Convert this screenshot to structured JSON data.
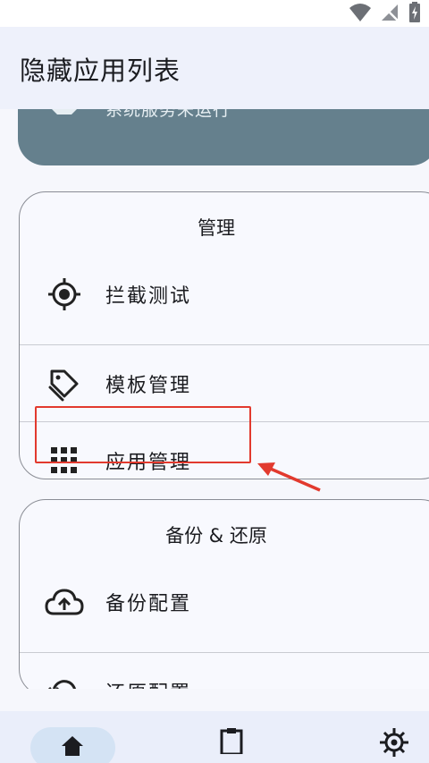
{
  "status_bar": {
    "icons": [
      "wifi-icon",
      "no-signal-icon",
      "battery-charging-icon"
    ]
  },
  "app_bar": {
    "title": "隐藏应用列表"
  },
  "status_card": {
    "text": "系统服务未运行",
    "icon": "service-icon",
    "color": "#65808d"
  },
  "manage_group": {
    "title": "管理",
    "items": [
      {
        "label": "拦截测试",
        "icon": "target-icon"
      },
      {
        "label": "模板管理",
        "icon": "tag-icon"
      },
      {
        "label": "应用管理",
        "icon": "grid-icon"
      }
    ]
  },
  "backup_group": {
    "title": "备份 & 还原",
    "items": [
      {
        "label": "备份配置",
        "icon": "cloud-upload-icon"
      },
      {
        "label": "还原配置",
        "icon": "restore-icon"
      }
    ]
  },
  "bottom_nav": {
    "items": [
      {
        "icon": "home-icon",
        "selected": true
      },
      {
        "icon": "logs-icon",
        "selected": false
      },
      {
        "icon": "settings-icon",
        "selected": false
      }
    ]
  },
  "annotation": {
    "highlight_color": "#e23a2e"
  }
}
